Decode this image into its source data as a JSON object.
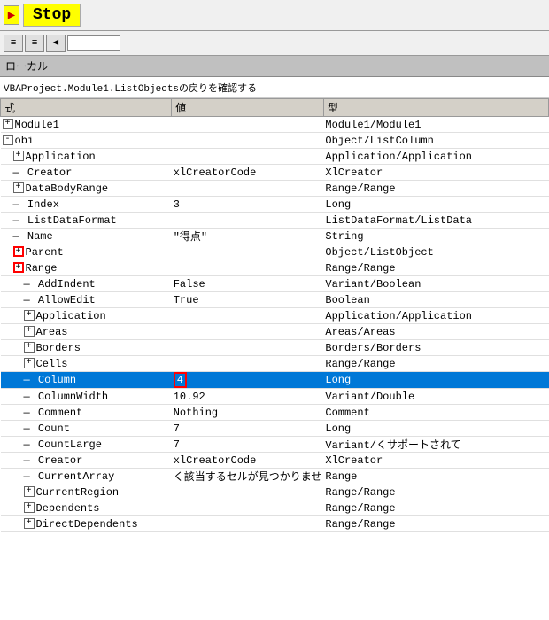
{
  "toolbar": {
    "stop_label": "Stop"
  },
  "toolbar2": {
    "btn1": "≡",
    "btn2": "≡",
    "btn3": "◄"
  },
  "local_bar": {
    "label": "ローカル"
  },
  "path_bar": {
    "path": "VBAProject.Module1.ListObjectsの戻りを確認する"
  },
  "table": {
    "headers": [
      "式",
      "値",
      "型"
    ],
    "rows": [
      {
        "indent": 0,
        "prefix": "plus",
        "name": "Module1",
        "value": "",
        "type": "Module1/Module1",
        "selected": false
      },
      {
        "indent": 0,
        "prefix": "minus",
        "name": "obi",
        "value": "",
        "type": "Object/ListColumn",
        "selected": false
      },
      {
        "indent": 1,
        "prefix": "plus",
        "name": "Application",
        "value": "",
        "type": "Application/Application",
        "selected": false
      },
      {
        "indent": 1,
        "prefix": "line",
        "name": "Creator",
        "value": "xlCreatorCode",
        "type": "XlCreator",
        "selected": false
      },
      {
        "indent": 1,
        "prefix": "plus",
        "name": "DataBodyRange",
        "value": "",
        "type": "Range/Range",
        "selected": false
      },
      {
        "indent": 1,
        "prefix": "line",
        "name": "Index",
        "value": "3",
        "type": "Long",
        "selected": false
      },
      {
        "indent": 1,
        "prefix": "line",
        "name": "ListDataFormat",
        "value": "",
        "type": "ListDataFormat/ListData",
        "selected": false
      },
      {
        "indent": 1,
        "prefix": "line",
        "name": "Name",
        "value": "\"得点\"",
        "type": "String",
        "selected": false
      },
      {
        "indent": 1,
        "prefix": "plus_red",
        "name": "Parent",
        "value": "",
        "type": "Object/ListObject",
        "selected": false
      },
      {
        "indent": 1,
        "prefix": "plus_red",
        "name": "Range",
        "value": "",
        "type": "Range/Range",
        "selected": false
      },
      {
        "indent": 2,
        "prefix": "line",
        "name": "AddIndent",
        "value": "False",
        "type": "Variant/Boolean",
        "selected": false
      },
      {
        "indent": 2,
        "prefix": "line",
        "name": "AllowEdit",
        "value": "True",
        "type": "Boolean",
        "selected": false
      },
      {
        "indent": 2,
        "prefix": "plus",
        "name": "Application",
        "value": "",
        "type": "Application/Application",
        "selected": false
      },
      {
        "indent": 2,
        "prefix": "plus",
        "name": "Areas",
        "value": "",
        "type": "Areas/Areas",
        "selected": false
      },
      {
        "indent": 2,
        "prefix": "plus",
        "name": "Borders",
        "value": "",
        "type": "Borders/Borders",
        "selected": false
      },
      {
        "indent": 2,
        "prefix": "plus",
        "name": "Cells",
        "value": "",
        "type": "Range/Range",
        "selected": false
      },
      {
        "indent": 2,
        "prefix": "line_selected",
        "name": "Column",
        "value": "4",
        "type": "Long",
        "selected": true
      },
      {
        "indent": 2,
        "prefix": "line",
        "name": "ColumnWidth",
        "value": "10.92",
        "type": "Variant/Double",
        "selected": false
      },
      {
        "indent": 2,
        "prefix": "line",
        "name": "Comment",
        "value": "Nothing",
        "type": "Comment",
        "selected": false
      },
      {
        "indent": 2,
        "prefix": "line",
        "name": "Count",
        "value": "7",
        "type": "Long",
        "selected": false
      },
      {
        "indent": 2,
        "prefix": "line",
        "name": "CountLarge",
        "value": "7",
        "type": "Variant/くサポートされて",
        "selected": false
      },
      {
        "indent": 2,
        "prefix": "line",
        "name": "Creator",
        "value": "xlCreatorCode",
        "type": "XlCreator",
        "selected": false
      },
      {
        "indent": 2,
        "prefix": "line",
        "name": "CurrentArray",
        "value": "く該当するセルが見つかりませ",
        "type": "Range",
        "selected": false
      },
      {
        "indent": 2,
        "prefix": "plus",
        "name": "CurrentRegion",
        "value": "",
        "type": "Range/Range",
        "selected": false
      },
      {
        "indent": 2,
        "prefix": "plus",
        "name": "Dependents",
        "value": "",
        "type": "Range/Range",
        "selected": false
      },
      {
        "indent": 2,
        "prefix": "plus",
        "name": "DirectDependents",
        "value": "",
        "type": "Range/Range",
        "selected": false
      }
    ]
  }
}
